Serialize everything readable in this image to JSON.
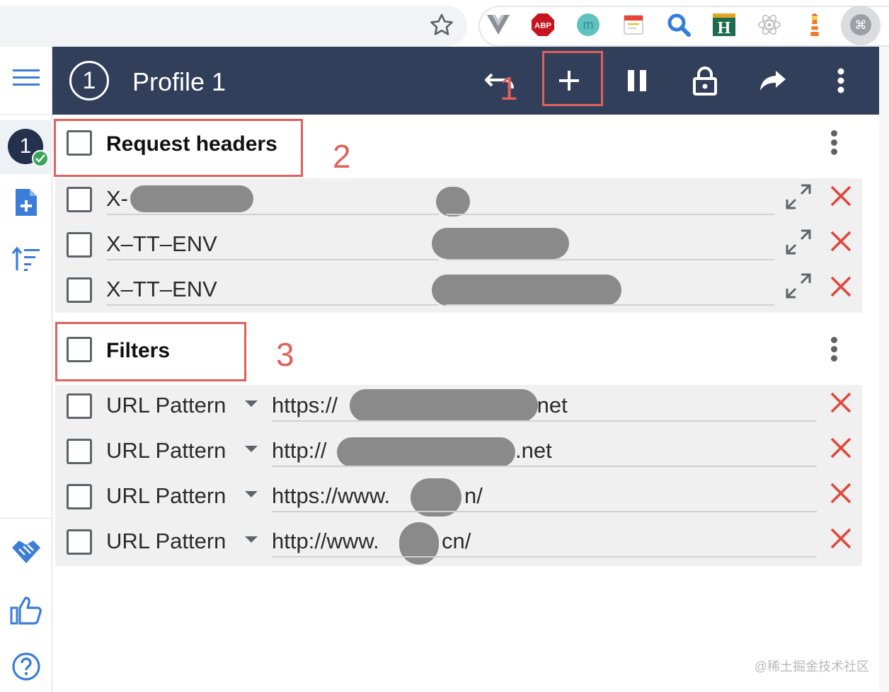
{
  "header": {
    "profile_number": "1",
    "profile_title": "Profile 1"
  },
  "rail": {
    "profile_badge": "1"
  },
  "request_headers": {
    "title": "Request headers",
    "rows": [
      {
        "name": "X-",
        "value": ""
      },
      {
        "name": "X–TT–ENV",
        "value": ""
      },
      {
        "name": "X–TT–ENV",
        "value": ""
      }
    ]
  },
  "filters": {
    "title": "Filters",
    "rows": [
      {
        "type": "URL Pattern",
        "prefix": "https://",
        "suffix": ".net"
      },
      {
        "type": "URL Pattern",
        "prefix": "http://",
        "suffix": ".net"
      },
      {
        "type": "URL Pattern",
        "prefix": "https://www.",
        "suffix": "n/"
      },
      {
        "type": "URL Pattern",
        "prefix": "http://www.",
        "suffix": "cn/"
      }
    ]
  },
  "annotations": {
    "a1": "1",
    "a2": "2",
    "a3": "3"
  },
  "watermark": "@稀土掘金技术社区",
  "colors": {
    "header_bg": "#323f5b",
    "annotation": "#e0615a",
    "delete": "#e0483c",
    "rail_icon": "#3b7dd8"
  },
  "icons": {
    "header": [
      "undo-icon",
      "add-icon",
      "pause-icon",
      "lock-icon",
      "share-icon",
      "more-vert-icon"
    ],
    "rail": [
      "menu-icon",
      "add-file-icon",
      "sort-icon",
      "handshake-icon",
      "thumbs-up-icon",
      "help-icon"
    ],
    "extensions": [
      "vue-devtools-icon",
      "adblock-plus-icon",
      "mercury-icon",
      "notes-icon",
      "search-ext-icon",
      "hacker-icon",
      "react-devtools-icon",
      "lighthouse-icon",
      "modheader-icon"
    ]
  }
}
